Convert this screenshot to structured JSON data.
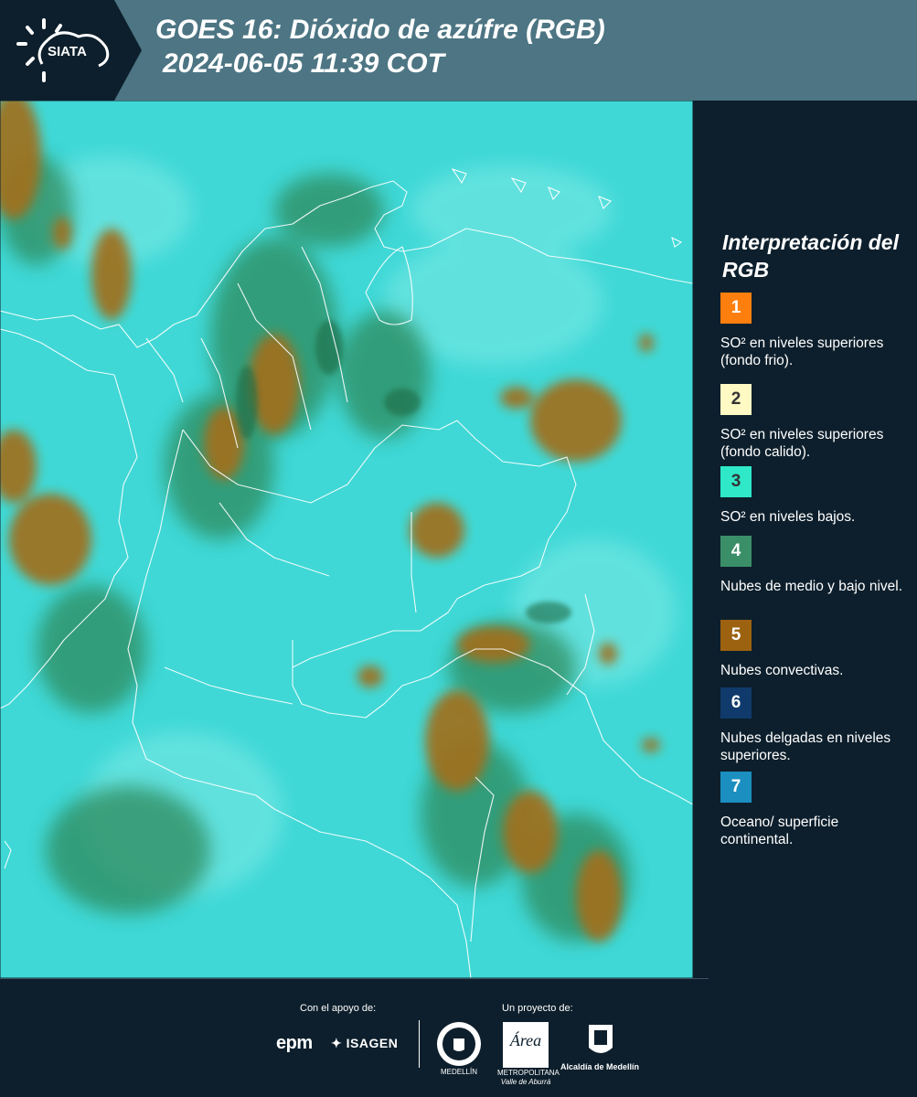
{
  "header": {
    "logo_text": "SIATA",
    "title_line1": "GOES 16: Dióxido de azúfre (RGB)",
    "title_line2": "2024-06-05 11:39 COT"
  },
  "legend": {
    "title": "Interpretación del RGB",
    "items": [
      {
        "num": "1",
        "color": "#ff7f0e",
        "desc": "SO² en niveles superiores (fondo frio)."
      },
      {
        "num": "2",
        "color": "#fff9c4",
        "desc": "SO² en niveles superiores (fondo calido)."
      },
      {
        "num": "3",
        "color": "#2ee8c8",
        "desc": "SO² en niveles bajos."
      },
      {
        "num": "4",
        "color": "#3a8f68",
        "desc": "Nubes de medio y bajo nivel."
      },
      {
        "num": "5",
        "color": "#9c6210",
        "desc": "Nubes convectivas."
      },
      {
        "num": "6",
        "color": "#0f3a6b",
        "desc": "Nubes delgadas en niveles superiores."
      },
      {
        "num": "7",
        "color": "#1b8fc0",
        "desc": "Oceano/ superficie continental."
      }
    ]
  },
  "footer": {
    "support_label": "Con el apoyo de:",
    "project_label": "Un proyecto de:",
    "epm": "epm",
    "isagen": "ISAGEN",
    "area_name": "Área",
    "area_sub1": "METROPOLITANA",
    "area_sub2": "Valle de Aburrá",
    "medellin_seal": "MEDELLÍN",
    "alcaldia": "Alcaldía de Medellín"
  },
  "colors": {
    "header_bg": "#4d7583",
    "logo_bg": "#0d1f2c",
    "page_bg": "#0d1f2c",
    "map_cyan": "#36dcd6",
    "map_green": "#2f8a5a",
    "map_brown": "#a0701e"
  }
}
